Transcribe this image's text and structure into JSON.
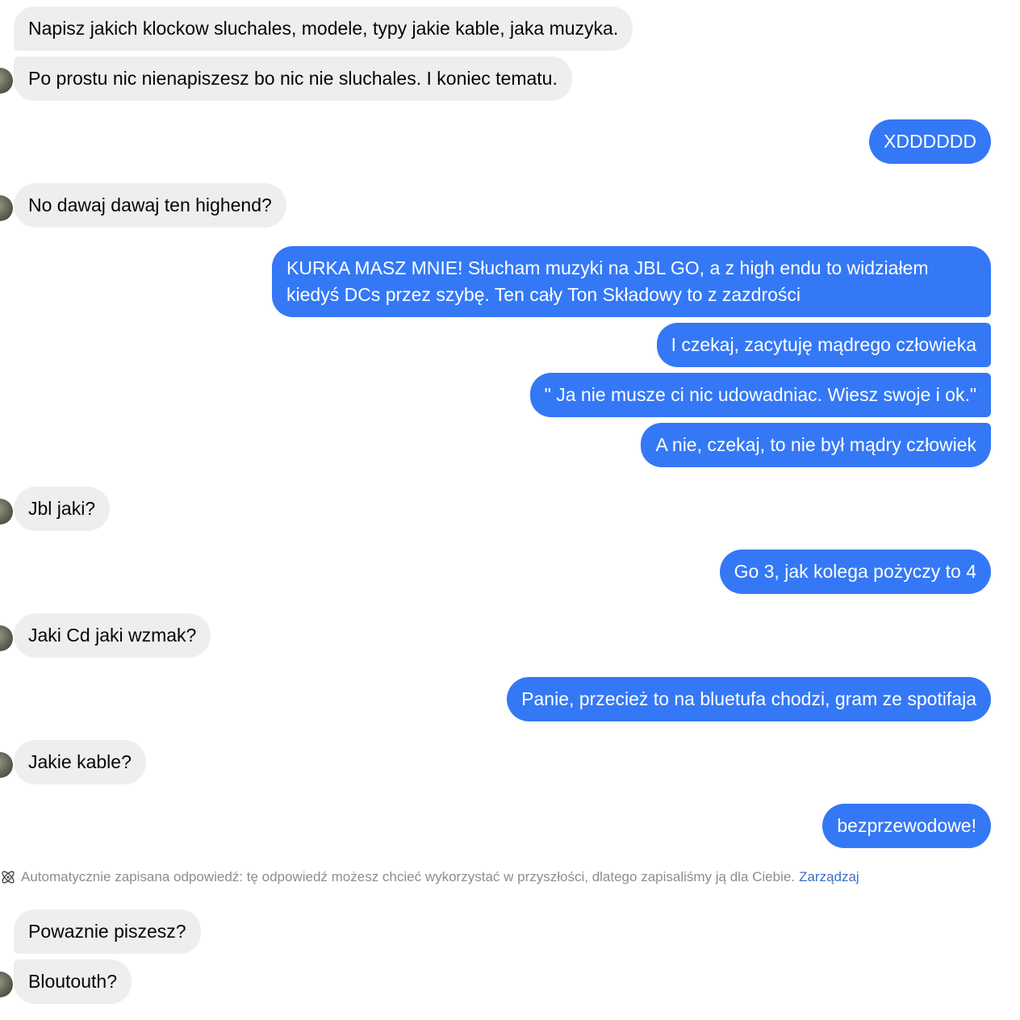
{
  "messages": [
    {
      "from": "them",
      "text": "Napisz jakich klockow sluchales, modele, typy jakie kable, jaka muzyka."
    },
    {
      "from": "them",
      "text": "Po prostu nic nienapiszesz bo nic nie sluchales. I koniec tematu."
    },
    {
      "from": "me",
      "text": "XDDDDDD"
    },
    {
      "from": "them",
      "text": "No dawaj dawaj ten highend?"
    },
    {
      "from": "me",
      "text": "KURKA MASZ MNIE! Słucham muzyki na JBL GO, a z high endu to widziałem kiedyś DCs przez szybę. Ten cały Ton Składowy to z zazdrości"
    },
    {
      "from": "me",
      "text": "I czekaj, zacytuję mądrego człowieka"
    },
    {
      "from": "me",
      "text": "\" Ja nie musze ci nic udowadniac. Wiesz swoje i ok.\""
    },
    {
      "from": "me",
      "text": "A nie, czekaj, to nie był mądry człowiek"
    },
    {
      "from": "them",
      "text": "Jbl jaki?"
    },
    {
      "from": "me",
      "text": "Go 3, jak kolega pożyczy to 4"
    },
    {
      "from": "them",
      "text": "Jaki Cd jaki wzmak?"
    },
    {
      "from": "me",
      "text": "Panie, przecież to na bluetufa chodzi, gram ze spotifaja"
    },
    {
      "from": "them",
      "text": "Jakie kable?"
    },
    {
      "from": "me",
      "text": "bezprzewodowe!"
    },
    {
      "from": "them",
      "text": "Powaznie piszesz?"
    },
    {
      "from": "them",
      "text": "Bloutouth?"
    }
  ],
  "saved_reply_note": {
    "icon": "atom-icon",
    "text": "Automatycznie zapisana odpowiedź: tę odpowiedź możesz chcieć wykorzystać w przyszłości, dlatego zapisaliśmy ją dla Ciebie.",
    "link": "Zarządzaj"
  },
  "colors": {
    "incoming_bubble": "#eeeeee",
    "outgoing_bubble": "#3478f6",
    "link": "#3a6fc4",
    "note_text": "#8a8d91"
  }
}
